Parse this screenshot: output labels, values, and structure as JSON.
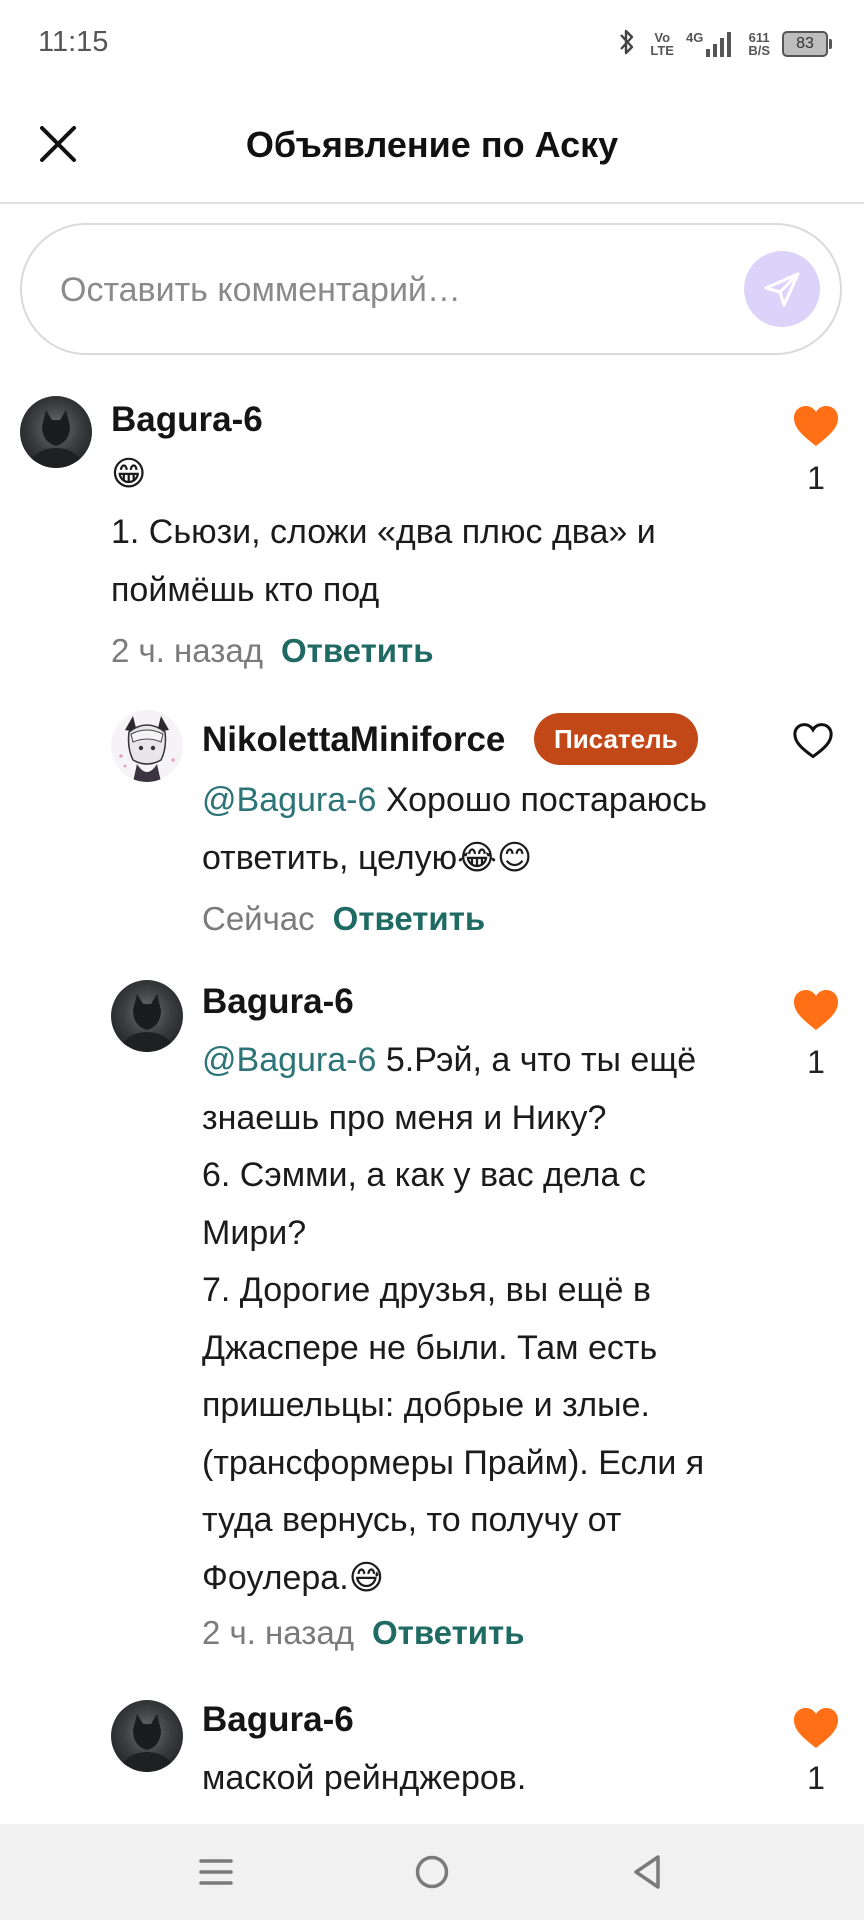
{
  "status_bar": {
    "time": "11:15",
    "volte_line1": "Vo",
    "volte_line2": "LTE",
    "network": "4G",
    "speed_line1": "611",
    "speed_line2": "B/S",
    "battery": "83"
  },
  "header": {
    "title": "Объявление по Аску",
    "close_icon": "close-icon"
  },
  "comment_input": {
    "placeholder": "Оставить комментарий…",
    "send_icon": "send-icon"
  },
  "colors": {
    "like_active": "#ff6f16",
    "badge": "#c24818",
    "reply": "#1f6a63",
    "mention": "#2c7477",
    "send_bg": "#dcd3fb"
  },
  "comments": [
    {
      "author": "Bagura-6",
      "emoji_line": "😁",
      "text": "1. Сьюзи, сложи «два плюс два» и поймёшь кто под",
      "time": "2 ч. назад",
      "reply_label": "Ответить",
      "liked": true,
      "likes": "1"
    },
    {
      "author": "NikolettaMiniforce",
      "badge": "Писатель",
      "mention": "@Bagura-6",
      "text": " Хорошо постараюсь ответить, целую😂😊",
      "time": "Сейчас",
      "reply_label": "Ответить",
      "liked": false
    },
    {
      "author": "Bagura-6",
      "mention": "@Bagura-6",
      "text_first": " 5.Рэй, а что ты ещё знаешь про меня и Нику?",
      "text_rest": "6. Сэмми, а как у вас дела с Мири?",
      "text_rest2": "7. Дорогие друзья, вы ещё в Джаспере не были. Там есть пришельцы: добрые и злые. (трансформеры Прайм). Если я туда вернусь, то получу от Фоулера.😅",
      "time": "2 ч. назад",
      "reply_label": "Ответить",
      "liked": true,
      "likes": "1"
    },
    {
      "author": "Bagura-6",
      "text": "маской рейнджеров.",
      "liked": true,
      "likes": "1"
    }
  ],
  "nav": {
    "menu_icon": "menu-icon",
    "home_icon": "home-icon",
    "back_icon": "back-icon"
  }
}
